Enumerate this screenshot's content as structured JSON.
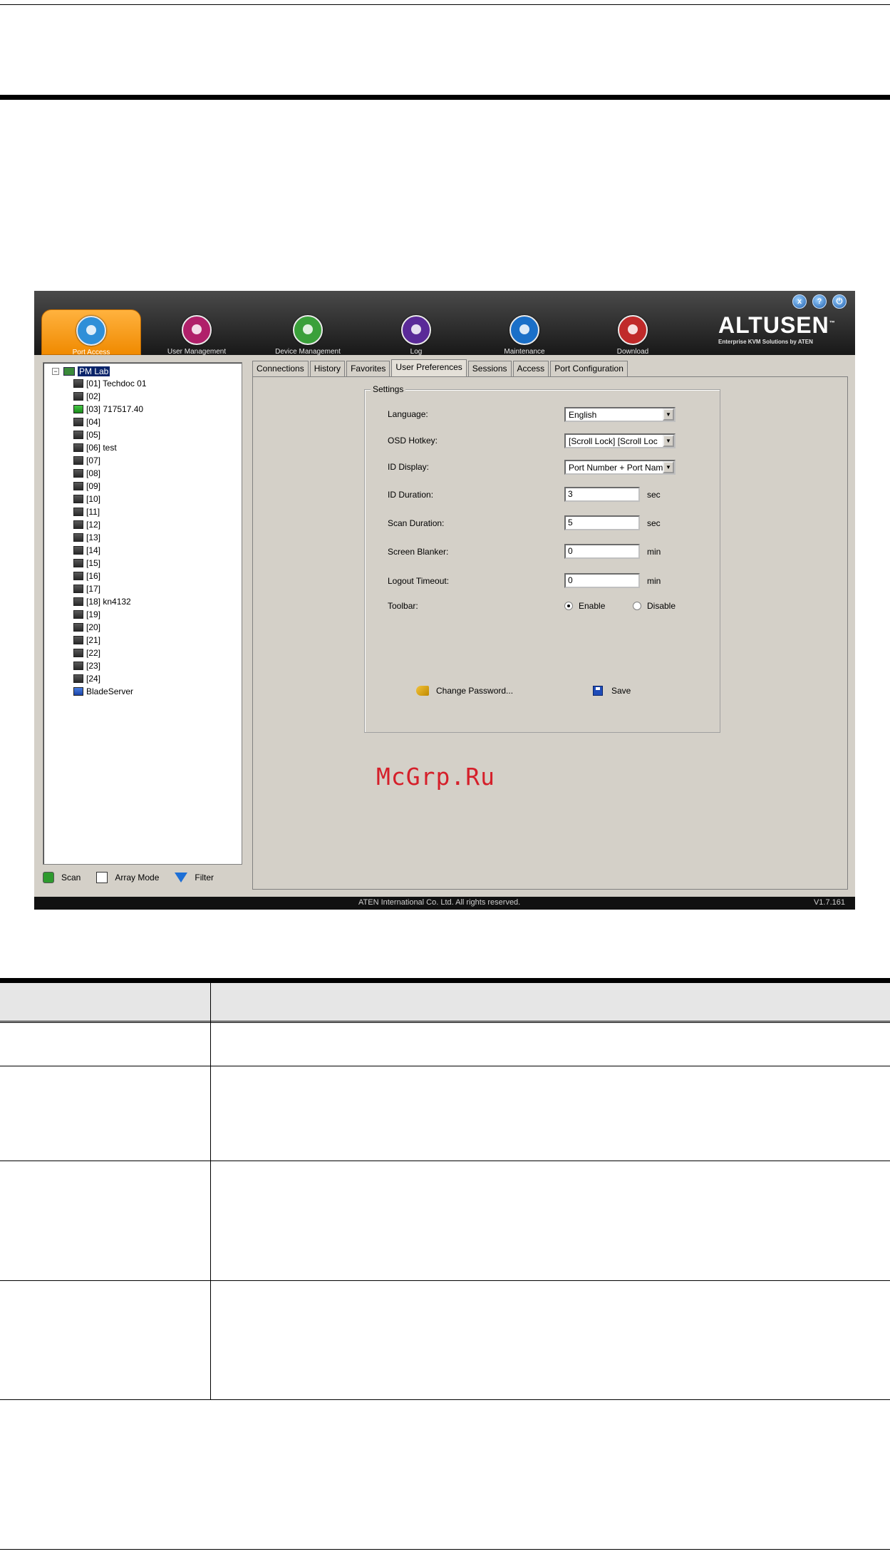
{
  "nav": {
    "items": [
      {
        "label": "Port Access",
        "color": "#2f8fd8"
      },
      {
        "label": "User Management",
        "color": "#b0206a"
      },
      {
        "label": "Device Management",
        "color": "#3aa03a"
      },
      {
        "label": "Log",
        "color": "#5a2a98"
      },
      {
        "label": "Maintenance",
        "color": "#1a6fc8"
      },
      {
        "label": "Download",
        "color": "#c02a2a"
      }
    ],
    "active": "Port Access"
  },
  "brand": {
    "name": "ALTUSEN",
    "tm": "™",
    "tagline": "Enterprise KVM Solutions by ATEN"
  },
  "window_controls": {
    "close": "x",
    "help": "?",
    "logout": "⏻"
  },
  "tree": {
    "root": "PM Lab",
    "items": [
      {
        "label": "[01] Techdoc 01",
        "state": "offline"
      },
      {
        "label": "[02]",
        "state": "offline"
      },
      {
        "label": "[03] 717517.40",
        "state": "online"
      },
      {
        "label": "[04]",
        "state": "offline"
      },
      {
        "label": "[05]",
        "state": "offline"
      },
      {
        "label": "[06] test",
        "state": "offline"
      },
      {
        "label": "[07]",
        "state": "offline"
      },
      {
        "label": "[08]",
        "state": "offline"
      },
      {
        "label": "[09]",
        "state": "offline"
      },
      {
        "label": "[10]",
        "state": "offline"
      },
      {
        "label": "[11]",
        "state": "offline"
      },
      {
        "label": "[12]",
        "state": "offline"
      },
      {
        "label": "[13]",
        "state": "offline"
      },
      {
        "label": "[14]",
        "state": "offline"
      },
      {
        "label": "[15]",
        "state": "offline"
      },
      {
        "label": "[16]",
        "state": "offline"
      },
      {
        "label": "[17]",
        "state": "offline"
      },
      {
        "label": "[18] kn4132",
        "state": "offline"
      },
      {
        "label": "[19]",
        "state": "offline"
      },
      {
        "label": "[20]",
        "state": "offline"
      },
      {
        "label": "[21]",
        "state": "offline"
      },
      {
        "label": "[22]",
        "state": "offline"
      },
      {
        "label": "[23]",
        "state": "offline"
      },
      {
        "label": "[24]",
        "state": "offline"
      },
      {
        "label": "BladeServer",
        "state": "blade"
      }
    ]
  },
  "bottom": {
    "scan": "Scan",
    "array": "Array Mode",
    "filter": "Filter"
  },
  "tabs": [
    "Connections",
    "History",
    "Favorites",
    "User Preferences",
    "Sessions",
    "Access",
    "Port Configuration"
  ],
  "active_tab": "User Preferences",
  "settings": {
    "title": "Settings",
    "language_label": "Language:",
    "language_value": "English",
    "osd_hotkey_label": "OSD Hotkey:",
    "osd_hotkey_value": "[Scroll Lock] [Scroll Loc",
    "id_display_label": "ID Display:",
    "id_display_value": "Port Number + Port Nam",
    "id_duration_label": "ID Duration:",
    "id_duration_value": "3",
    "id_duration_unit": "sec",
    "scan_duration_label": "Scan Duration:",
    "scan_duration_value": "5",
    "scan_duration_unit": "sec",
    "screen_blanker_label": "Screen Blanker:",
    "screen_blanker_value": "0",
    "screen_blanker_unit": "min",
    "logout_timeout_label": "Logout Timeout:",
    "logout_timeout_value": "0",
    "logout_timeout_unit": "min",
    "toolbar_label": "Toolbar:",
    "toolbar_enable": "Enable",
    "toolbar_disable": "Disable",
    "toolbar_selected": "Enable",
    "change_password": "Change Password...",
    "save": "Save"
  },
  "status": {
    "copyright": "ATEN International Co. Ltd. All rights reserved.",
    "version": "V1.7.161"
  },
  "watermark": "McGrp.Ru"
}
